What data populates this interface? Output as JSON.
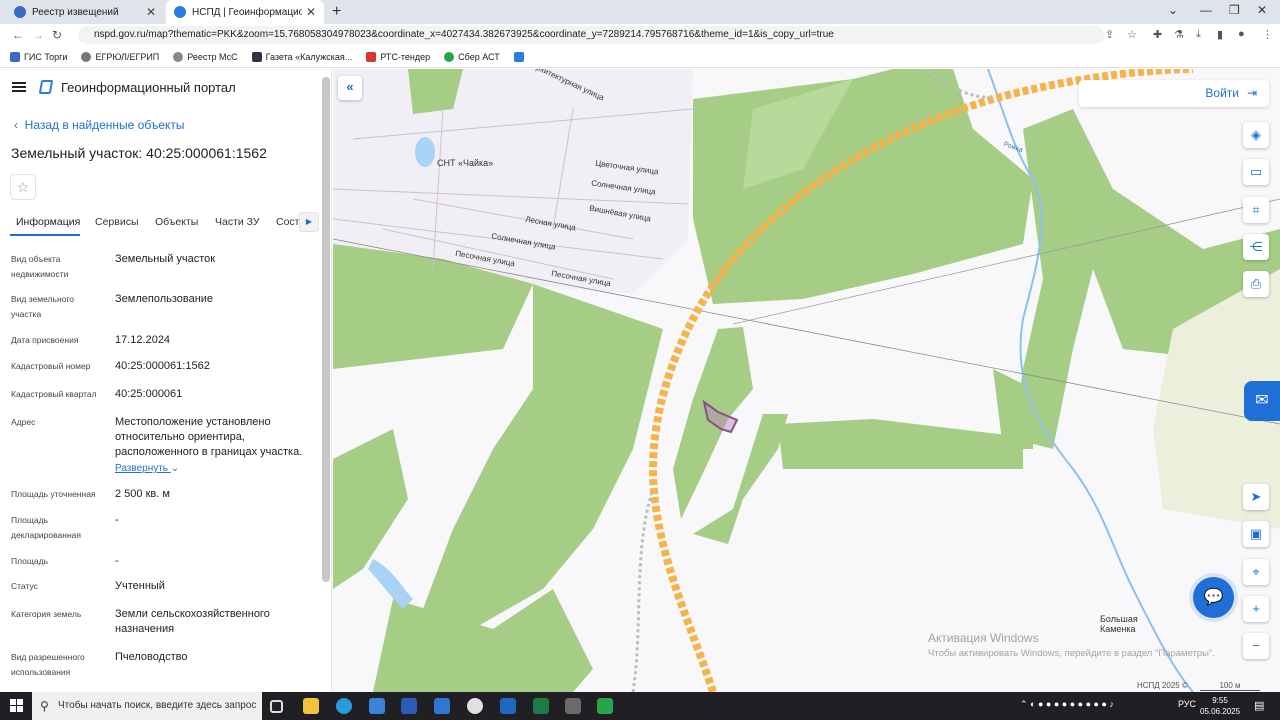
{
  "browser": {
    "tabs": [
      {
        "title": "Реестр извещений",
        "active": false
      },
      {
        "title": "НСПД | Геоинформационный п",
        "active": true
      }
    ],
    "url": "nspd.gov.ru/map?thematic=PKK&zoom=15.768058304978023&coordinate_x=4027434.382673925&coordinate_y=7289214.795768716&theme_id=1&is_copy_url=true",
    "bookmarks": [
      "ГИС Торги",
      "ЕГРЮЛ/ЕГРИП",
      "Реестр МсС",
      "Газета «Калужская...",
      "РТС-тендер",
      "Сбер АСТ"
    ]
  },
  "panel": {
    "portal_title": "Геоинформационный портал",
    "back_link": "Назад в найденные объекты",
    "title": "Земельный участок: 40:25:000061:1562",
    "tabs": [
      "Информация",
      "Сервисы",
      "Объекты",
      "Части ЗУ",
      "Соста"
    ],
    "properties": [
      {
        "label": "Вид объекта недвижимости",
        "value": "Земельный участок"
      },
      {
        "label": "Вид земельного участка",
        "value": "Землепользование"
      },
      {
        "label": "Дата присвоения",
        "value": "17.12.2024"
      },
      {
        "label": "Кадастровый номер",
        "value": "40:25:000061:1562"
      },
      {
        "label": "Кадастровый квартал",
        "value": "40:25:000061"
      },
      {
        "label": "Адрес",
        "value": "Местоположение установлено относительно ориентира, расположенного в границах участка."
      },
      {
        "label": "Площадь уточненная",
        "value": "2 500 кв. м"
      },
      {
        "label": "Площадь декларированная",
        "value": "-"
      },
      {
        "label": "Площадь",
        "value": "-"
      },
      {
        "label": "Статус",
        "value": "Учтенный"
      },
      {
        "label": "Категория земель",
        "value": "Земли сельскохозяйственного назначения"
      },
      {
        "label": "Вид разрешенного использования",
        "value": "Пчеловодство"
      }
    ],
    "expand_link": "Развернуть"
  },
  "map": {
    "login": "Войти",
    "labels": [
      "СНТ «Чайка»",
      "Архитектурная улица",
      "Цветочная улица",
      "Солнечная улица",
      "Вишнёвая улица",
      "Лесная улица",
      "Солнечная улица",
      "Песочная улица",
      "Песочная улица",
      "Большая Каменка",
      "Рожка"
    ],
    "attribution": "НСПД 2025 ©",
    "scale": "100 м",
    "watermark_title": "Активация Windows",
    "watermark_text": "Чтобы активировать Windows, перейдите в раздел \"Параметры\".",
    "colors": {
      "forest": "#a5cd85",
      "road": "#f6b34c",
      "snt": "#f2eef6",
      "parcel": "#8a4f8a"
    }
  },
  "taskbar": {
    "search_placeholder": "Чтобы начать поиск, введите здесь запрос",
    "lang": "РУС",
    "time": "9:55",
    "date": "05.06.2025"
  }
}
